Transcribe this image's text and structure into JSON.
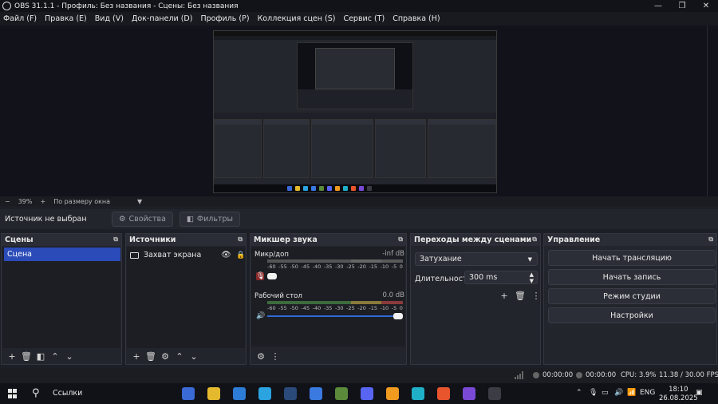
{
  "window": {
    "title": "OBS 31.1.1 - Профиль: Без названия - Сцены: Без названия",
    "controls": {
      "minimize": "—",
      "maximize": "❐",
      "close": "✕"
    }
  },
  "menu": [
    "Файл (F)",
    "Правка (E)",
    "Вид (V)",
    "Док-панели (D)",
    "Профиль (P)",
    "Коллекция сцен (S)",
    "Сервис (T)",
    "Справка (H)"
  ],
  "preview": {
    "zoom_minus": "−",
    "zoom": "39%",
    "zoom_plus": "+",
    "fit_mode": "По размеру окна"
  },
  "source_toolbar": {
    "no_source": "Источник не выбран",
    "properties": "Свойства",
    "filters": "Фильтры"
  },
  "scenes": {
    "title": "Сцены",
    "items": [
      "Сцена"
    ],
    "footer": [
      "+",
      "🗑",
      "◧",
      "⌃",
      "⌄"
    ]
  },
  "sources": {
    "title": "Источники",
    "items": [
      {
        "name": "Захват экрана"
      }
    ],
    "footer": [
      "+",
      "🗑",
      "⚙",
      "⌃",
      "⌄"
    ]
  },
  "mixer": {
    "title": "Микшер звука",
    "ticks": [
      "-60",
      "-55",
      "-50",
      "-45",
      "-40",
      "-35",
      "-30",
      "-25",
      "-20",
      "-15",
      "-10",
      "-5",
      "0"
    ],
    "channels": [
      {
        "name": "Микр/доп",
        "db": "-inf dB",
        "muted": true,
        "level": 0
      },
      {
        "name": "Рабочий стол",
        "db": "0.0 dB",
        "muted": false,
        "level": 1
      }
    ],
    "footer": [
      "⚙",
      "⋮"
    ]
  },
  "transitions": {
    "title": "Переходы между сценами",
    "selected": "Затухание",
    "duration_label": "Длительность",
    "duration": "300 ms"
  },
  "controls": {
    "title": "Управление",
    "buttons": [
      "Начать трансляцию",
      "Начать запись",
      "Режим студии",
      "Настройки"
    ]
  },
  "status": {
    "stream_time": "00:00:00",
    "record_time": "00:00:00",
    "cpu": "CPU: 3.9%",
    "fps": "11.38 / 30.00 FPS"
  },
  "taskbar": {
    "search": "Ссылки",
    "lang": "ENG",
    "time": "18:10",
    "date": "26.08.2025",
    "apps": [
      {
        "name": "store",
        "color": "#3a6ad6"
      },
      {
        "name": "explorer",
        "color": "#e5b92e"
      },
      {
        "name": "app-p",
        "color": "#2d7cd6"
      },
      {
        "name": "telegram",
        "color": "#2aa3e0"
      },
      {
        "name": "steam",
        "color": "#2a4a7a"
      },
      {
        "name": "app-blue",
        "color": "#3a7ae0"
      },
      {
        "name": "minecraft",
        "color": "#5a8a3a"
      },
      {
        "name": "discord",
        "color": "#5865f2"
      },
      {
        "name": "sublime",
        "color": "#f09a20"
      },
      {
        "name": "app-shield",
        "color": "#1fb0c8"
      },
      {
        "name": "brave",
        "color": "#e8552d"
      },
      {
        "name": "app-purple",
        "color": "#7a4ad6"
      },
      {
        "name": "obs",
        "color": "#3c3c44"
      }
    ]
  }
}
